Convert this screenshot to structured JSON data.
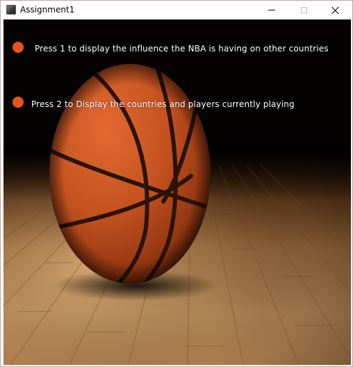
{
  "window": {
    "title": "Assignment1",
    "controls": {
      "minimize_icon": "minimize-icon",
      "maximize_icon": "maximize-icon",
      "close_icon": "close-icon"
    }
  },
  "menu": {
    "options": [
      {
        "label": "Press 1 to display the influence the NBA is having on other countries"
      },
      {
        "label": "Press 2 to Display the countries and players currently playing"
      }
    ]
  },
  "background_image": "basketball-on-hardwood-court",
  "colors": {
    "bullet": "#e8541b",
    "menu_text": "#ffffff",
    "backdrop": "#050302"
  }
}
